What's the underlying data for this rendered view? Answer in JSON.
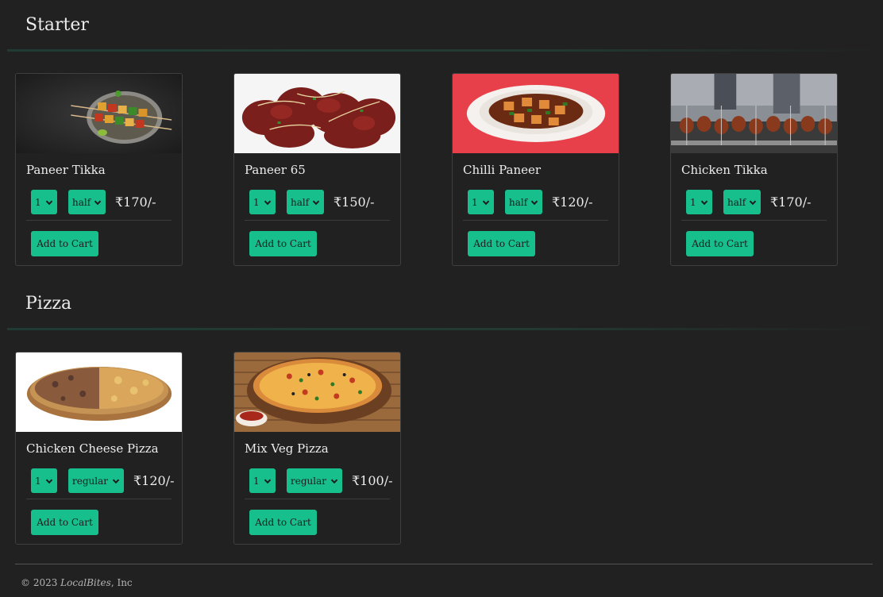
{
  "sections": [
    {
      "title": "Starter",
      "items": [
        {
          "name": "Paneer Tikka",
          "qty": "1",
          "size": "half",
          "price": "₹170/-",
          "add_label": "Add to Cart",
          "image": "paneer-tikka-image"
        },
        {
          "name": "Paneer 65",
          "qty": "1",
          "size": "half",
          "price": "₹150/-",
          "add_label": "Add to Cart",
          "image": "paneer-65-image"
        },
        {
          "name": "Chilli Paneer",
          "qty": "1",
          "size": "half",
          "price": "₹120/-",
          "add_label": "Add to Cart",
          "image": "chilli-paneer-image"
        },
        {
          "name": "Chicken Tikka",
          "qty": "1",
          "size": "half",
          "price": "₹170/-",
          "add_label": "Add to Cart",
          "image": "chicken-tikka-image"
        }
      ]
    },
    {
      "title": "Pizza",
      "items": [
        {
          "name": "Chicken Cheese Pizza",
          "qty": "1",
          "size": "regular",
          "price": "₹120/-",
          "add_label": "Add to Cart",
          "image": "chicken-cheese-pizza-image"
        },
        {
          "name": "Mix Veg Pizza",
          "qty": "1",
          "size": "regular",
          "price": "₹100/-",
          "add_label": "Add to Cart",
          "image": "mix-veg-pizza-image"
        }
      ]
    }
  ],
  "footer": {
    "prefix": "© 2023 ",
    "brand": "LocalBites",
    "suffix": ", Inc"
  },
  "colors": {
    "accent": "#17bf8d",
    "background": "#212121"
  }
}
